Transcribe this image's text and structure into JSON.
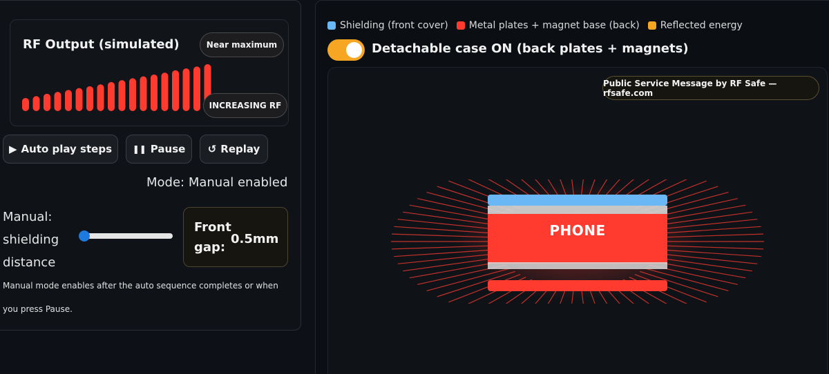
{
  "rf_card": {
    "title": "RF Output (simulated)",
    "status_label": "Near maximum",
    "trend_label": "INCREASING RF",
    "bar_levels": [
      0.28,
      0.32,
      0.37,
      0.41,
      0.45,
      0.49,
      0.53,
      0.57,
      0.62,
      0.66,
      0.7,
      0.74,
      0.78,
      0.82,
      0.87,
      0.91,
      0.95,
      1.0
    ],
    "bar_color": "#ff3b30"
  },
  "controls": {
    "auto_play_label": "Auto play steps",
    "auto_play_icon": "play-icon",
    "pause_label": "Pause",
    "pause_icon": "pause-icon",
    "replay_label": "Replay",
    "replay_icon": "replay-icon"
  },
  "mode_text": "Mode: Manual enabled",
  "manual": {
    "label": "Manual: shielding distance",
    "slider_value": 0,
    "gap_label": "Front gap:",
    "gap_value": "0.5mm",
    "note": "Manual mode enables after the auto sequence completes or when you press Pause."
  },
  "legend": [
    {
      "label": "Shielding (front cover)",
      "color": "#6ab7f5"
    },
    {
      "label": "Metal plates + magnet base (back)",
      "color": "#ff3b30"
    },
    {
      "label": "Reflected energy",
      "color": "#f6a623"
    }
  ],
  "toggle": {
    "label": "Detachable case ON (back plates + magnets)",
    "on": true,
    "color": "#f6a623"
  },
  "viz": {
    "psa_label": "Public Service Message by RF Safe — rfsafe.com",
    "phone_label": "PHONE"
  }
}
